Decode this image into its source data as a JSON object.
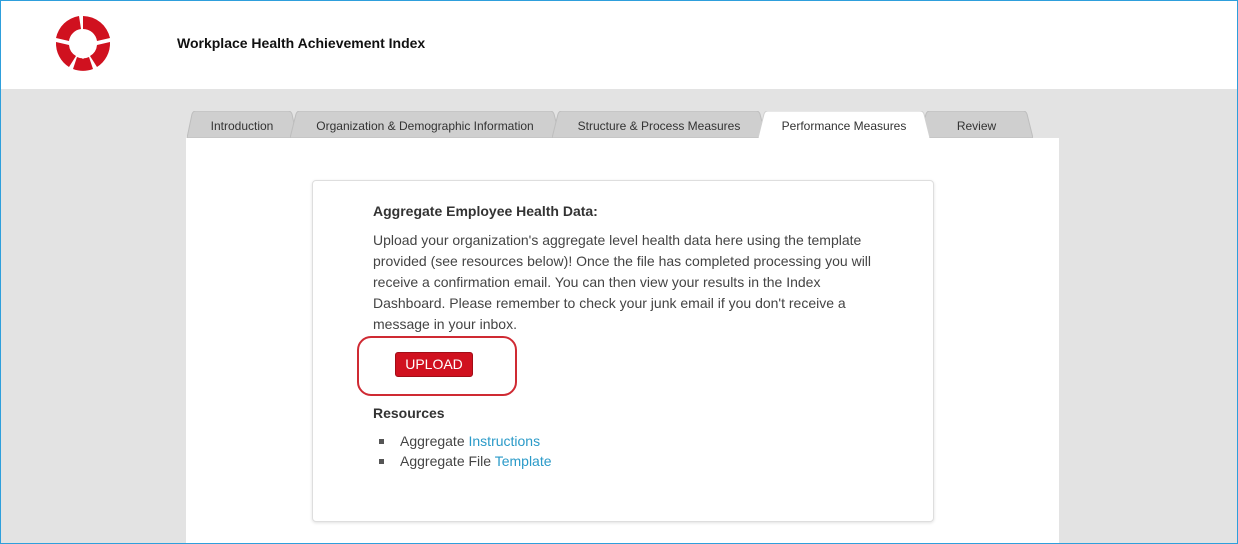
{
  "app": {
    "title": "Workplace Health Achievement Index",
    "logo_icon": "heart-logo-icon",
    "brand_color": "#d0111f"
  },
  "tabs": [
    {
      "label": "Introduction",
      "active": false
    },
    {
      "label": "Organization & Demographic Information",
      "active": false
    },
    {
      "label": "Structure & Process Measures",
      "active": false
    },
    {
      "label": "Performance Measures",
      "active": true
    },
    {
      "label": "Review",
      "active": false
    }
  ],
  "main": {
    "heading": "Aggregate Employee Health Data:",
    "description": "Upload your organization's aggregate level health data here using the template provided (see resources below)! Once the file has completed processing you will receive a confirmation email. You can then view your results in the Index Dashboard. Please remember to check your junk email if you don't receive a message in your inbox.",
    "upload_label": "UPLOAD",
    "resources_heading": "Resources",
    "resources": [
      {
        "prefix": "Aggregate",
        "link_text": "Instructions"
      },
      {
        "prefix": "Aggregate File",
        "link_text": "Template"
      }
    ]
  },
  "colors": {
    "link": "#2a9ac8",
    "highlight_outline": "#cf2a33",
    "background_gray": "#e3e3e3",
    "frame_border": "#2e9fdc"
  }
}
